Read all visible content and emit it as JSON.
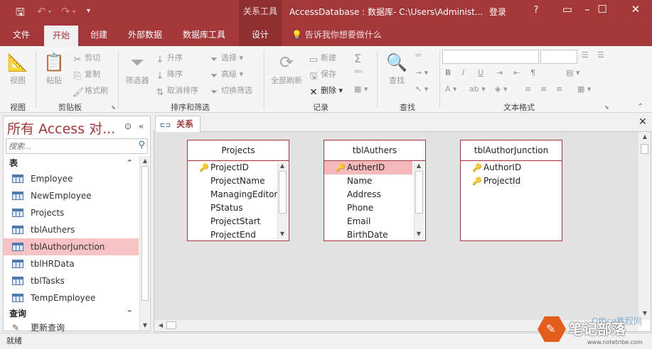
{
  "titlebar": {
    "context_tab": "关系工具",
    "title": "AccessDatabase : 数据库- C:\\Users\\Administ...",
    "login": "登录",
    "help": "?"
  },
  "tabs": [
    {
      "label": "文件"
    },
    {
      "label": "开始"
    },
    {
      "label": "创建"
    },
    {
      "label": "外部数据"
    },
    {
      "label": "数据库工具"
    },
    {
      "label": "设计"
    }
  ],
  "tell_me": "告诉我你想要做什么",
  "ribbon": {
    "view": {
      "button": "视图",
      "group": "视图"
    },
    "clipboard": {
      "paste": "粘贴",
      "cut": "剪切",
      "copy": "复制",
      "format_painter": "格式刷",
      "group": "剪贴板"
    },
    "sort": {
      "filter": "筛选器",
      "asc": "升序",
      "desc": "降序",
      "clear": "取消排序",
      "select": "选择",
      "advanced": "高级",
      "toggle": "切换筛选",
      "group": "排序和筛选"
    },
    "records": {
      "refresh": "全部刷新",
      "new": "新建",
      "save": "保存",
      "delete": "删除",
      "group": "记录"
    },
    "find": {
      "find": "查找",
      "group": "查找"
    },
    "text": {
      "group": "文本格式"
    }
  },
  "nav": {
    "title": "所有 Access 对...",
    "search_placeholder": "搜索...",
    "section_tables": "表",
    "tables": [
      "Employee",
      "NewEmployee",
      "Projects",
      "tblAuthers",
      "tblAuthorJunction",
      "tblHRData",
      "tblTasks",
      "TempEmployee"
    ],
    "section_queries": "查询",
    "queries": [
      "更新查询"
    ]
  },
  "doc_tab": "关系",
  "tables": [
    {
      "name": "Projects",
      "fields": [
        "ProjectID",
        "ProjectName",
        "ManagingEditor",
        "PStatus",
        "ProjectStart",
        "ProjectEnd"
      ]
    },
    {
      "name": "tblAuthers",
      "fields": [
        "AutherID",
        "Name",
        "Address",
        "Phone",
        "Email",
        "BirthDate"
      ]
    },
    {
      "name": "tblAuthorJunction",
      "fields": [
        "AuthorID",
        "ProjectId"
      ]
    }
  ],
  "status": "就绪",
  "watermark": {
    "main": "笔记部落",
    "faint": "Office教程网",
    "sub": "www.notetribe.com"
  }
}
